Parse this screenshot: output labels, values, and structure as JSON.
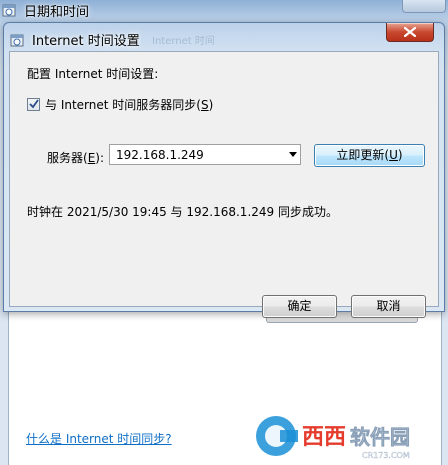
{
  "parent": {
    "title": "日期和时间",
    "help_link": "什么是 Internet 时间同步?"
  },
  "dialog": {
    "title": "Internet 时间设置",
    "title_ghost": "Internet 时间",
    "config_label": "配置 Internet 时间设置:",
    "sync_checkbox": {
      "prefix": "与 Internet 时间服务器同步(",
      "mnemonic": "S",
      "suffix": ")",
      "checked": true
    },
    "server_label": {
      "prefix": "服务器(",
      "mnemonic": "E",
      "suffix": "):"
    },
    "server_value": "192.168.1.249",
    "update_button": {
      "prefix": "立即更新(",
      "mnemonic": "U",
      "suffix": ")"
    },
    "status": "时钟在 2021/5/30 19:45 与 192.168.1.249 同步成功。",
    "ok_label": "确定",
    "cancel_label": "取消"
  },
  "watermark": {
    "text1": "西西",
    "text2": "软件园",
    "sub": "CR173.COM"
  },
  "colors": {
    "link": "#0f6fc6",
    "accent": "#3c7fb1",
    "close": "#c9482f"
  },
  "icons": [
    "clock-icon",
    "close-icon",
    "checkmark-icon",
    "chevron-down-icon"
  ]
}
